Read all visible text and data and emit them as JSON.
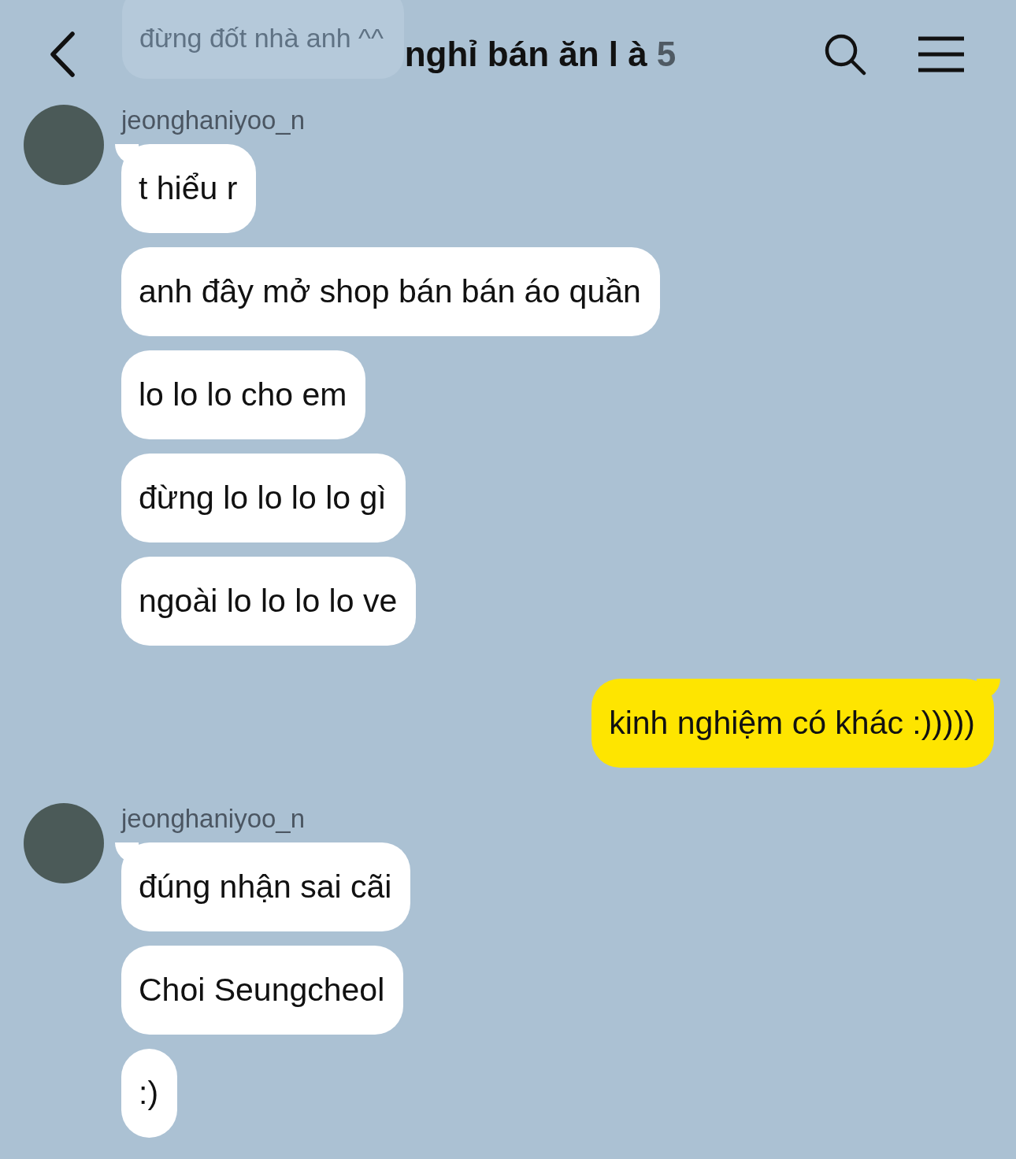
{
  "header": {
    "title": "nghỉ bán ăn l à",
    "member_count": "5"
  },
  "partial_message": {
    "text": "đừng đốt nhà anh ^^"
  },
  "messages": [
    {
      "kind": "received",
      "sender": "jeonghaniyoo_n",
      "bubbles": [
        "t hiểu r",
        "anh đây mở shop bán bán áo quần",
        "lo lo lo cho em",
        "đừng lo lo lo lo gì",
        "ngoài lo lo lo lo ve"
      ]
    },
    {
      "kind": "sent",
      "bubbles": [
        "kinh nghiệm có khác :)))))"
      ]
    },
    {
      "kind": "received",
      "sender": "jeonghaniyoo_n",
      "bubbles": [
        "đúng nhận sai cãi",
        "Choi Seungcheol",
        ":)"
      ]
    }
  ]
}
